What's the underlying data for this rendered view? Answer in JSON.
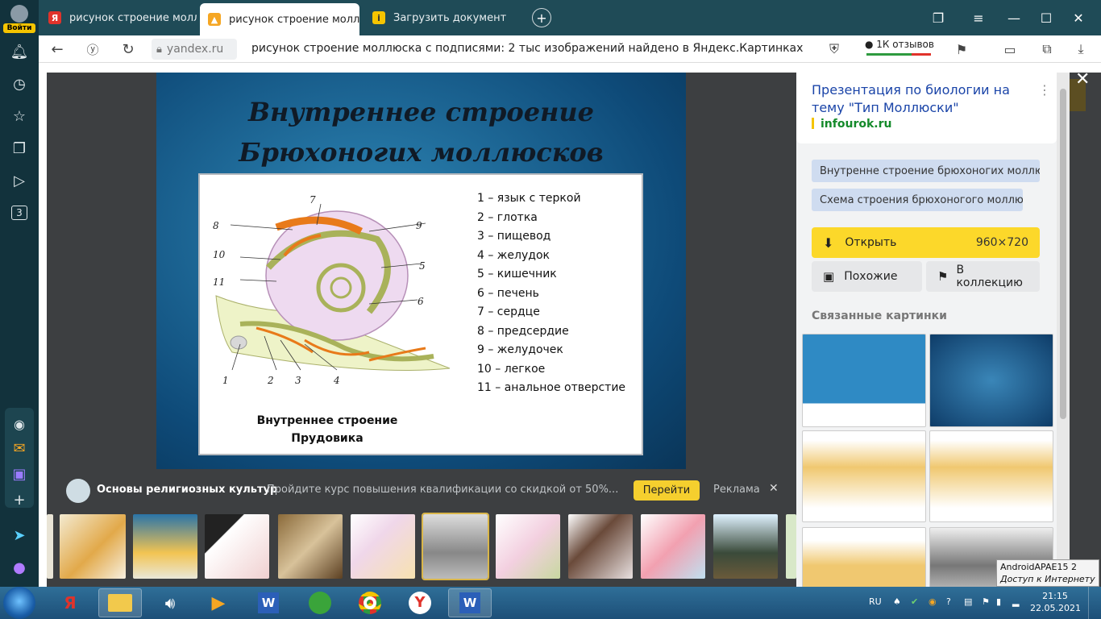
{
  "sidebar": {
    "login_label": "Войти",
    "tab_count_badge": "3"
  },
  "tabs": [
    {
      "label": "рисунок строение моллю",
      "favicon": "Я"
    },
    {
      "label": "рисунок строение моллю",
      "favicon": "img"
    },
    {
      "label": "Загрузить документ",
      "favicon": "i"
    }
  ],
  "address": {
    "domain": "yandex.ru",
    "page_title": "рисунок строение моллюска с подписями: 2 тыс изображений найдено в Яндекс.Картинках",
    "reviews": "1К отзывов"
  },
  "slide": {
    "title_line1": "Внутреннее строение",
    "title_line2": "Брюхоногих моллюсков",
    "legend": [
      "1 – язык с теркой",
      "2 – глотка",
      "3 – пищевод",
      "4 – желудок",
      "5 – кишечник",
      "6 – печень",
      "7 – сердце",
      "8 – предсердие",
      "9 – желудочек",
      "10 – легкое",
      "11 – анальное отверстие"
    ],
    "caption_line1": "Внутреннее строение",
    "caption_line2": "Прудовика",
    "labels": [
      "1",
      "2",
      "3",
      "4",
      "5",
      "6",
      "7",
      "8",
      "9",
      "10",
      "11"
    ]
  },
  "ad": {
    "title": "Основы религиозных культур",
    "text": "Пройдите курс повышения квалификации со скидкой от 50%...",
    "button": "Перейти",
    "label": "Реклама"
  },
  "panel": {
    "title": "Презентация по биологии на тему \"Тип Моллюски\"",
    "domain": "infourok.ru",
    "chips": [
      "Внутренне строение брюхоногих моллюсков",
      "Схема строения брюхоногого моллюска"
    ],
    "open_label": "Открыть",
    "open_size": "960×720",
    "similar_label": "Похожие",
    "collection_label": "В коллекцию",
    "related_label": "Связанные картинки"
  },
  "tooltip": {
    "line1": "AndroidAPAE15  2",
    "line2": "Доступ к Интернету"
  },
  "taskbar": {
    "lang": "RU",
    "time": "21:15",
    "date": "22.05.2021"
  }
}
